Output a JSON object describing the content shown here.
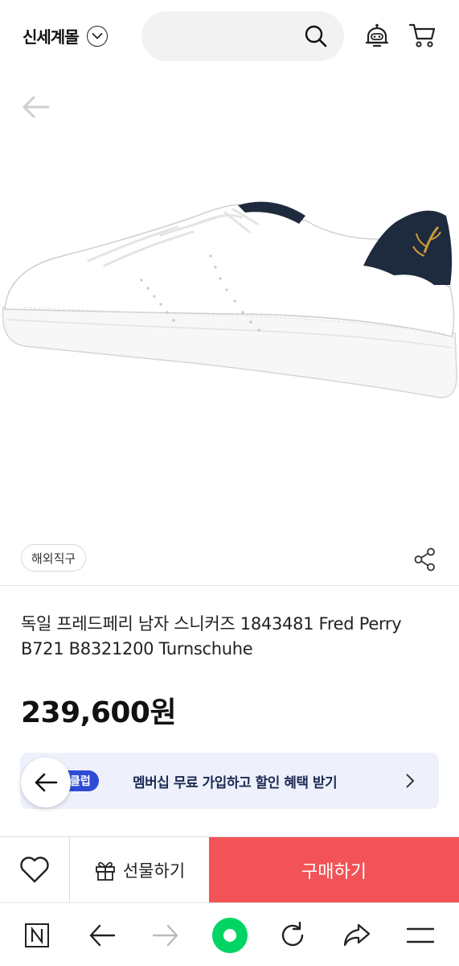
{
  "header": {
    "logo": "신세계몰",
    "search_placeholder": ""
  },
  "product": {
    "tag": "해외직구",
    "title": "독일 프레드페리 남자 스니커즈 1843481 Fred Perry B721 B8321200 Turnschuhe",
    "price": "239,600원"
  },
  "banner": {
    "badge": "클럽",
    "text": "멤버십 무료 가입하고 할인 혜택 받기"
  },
  "actions": {
    "gift_label": "선물하기",
    "buy_label": "구매하기"
  },
  "colors": {
    "buy_button": "#f25358",
    "banner_bg": "#eef1fb",
    "badge_bg": "#2f4bd6",
    "browser_green": "#00d564"
  },
  "icons": [
    "chevron-down-icon",
    "search-icon",
    "bot-icon",
    "cart-icon",
    "back-arrow-icon",
    "share-icon",
    "chevron-right-icon",
    "heart-icon",
    "gift-icon",
    "n-logo-icon",
    "forward-icon",
    "refresh-icon",
    "share-arrow-icon",
    "menu-icon"
  ]
}
